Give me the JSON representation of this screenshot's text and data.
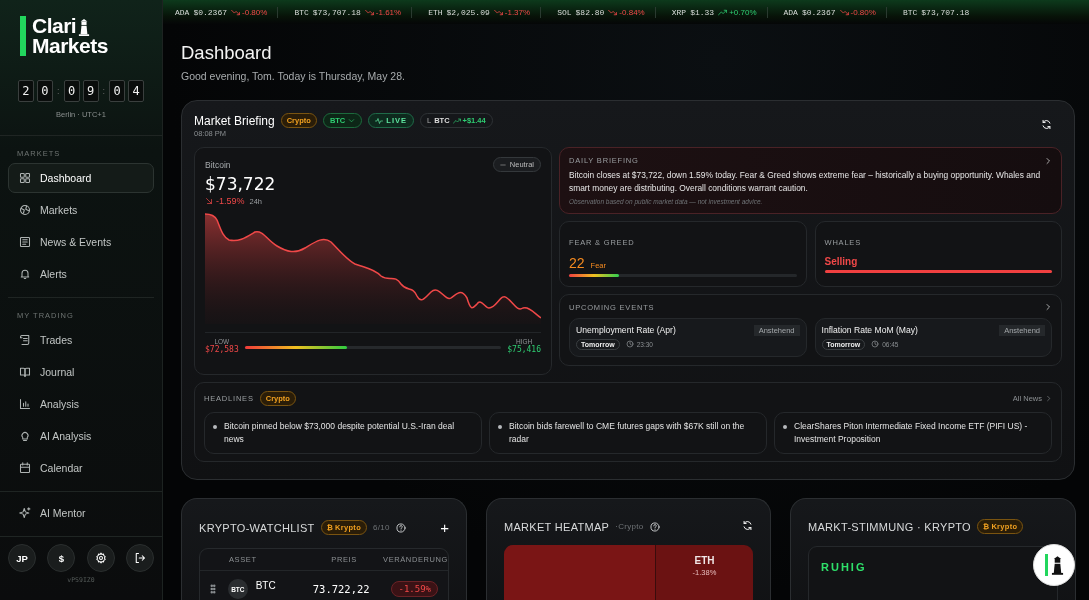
{
  "ticker": [
    {
      "symbol": "ADA",
      "price": "$0.2367",
      "change": "-0.80%",
      "falling": true
    },
    {
      "symbol": "BTC",
      "price": "$73,707.18",
      "change": "-1.61%",
      "falling": true
    },
    {
      "symbol": "ETH",
      "price": "$2,025.09",
      "change": "-1.37%",
      "falling": true
    },
    {
      "symbol": "SOL",
      "price": "$82.80",
      "change": "-0.84%",
      "falling": true
    },
    {
      "symbol": "XRP",
      "price": "$1.33",
      "change": "+0.70%",
      "falling": false
    },
    {
      "symbol": "ADA",
      "price": "$0.2367",
      "change": "-0.80%",
      "falling": true
    },
    {
      "symbol": "BTC",
      "price": "$73,707.18"
    }
  ],
  "sidebar": {
    "logo": {
      "line1": "Clari",
      "line2": "Markets"
    },
    "clock": {
      "groups": [
        [
          "2",
          "0"
        ],
        [
          "0",
          "9"
        ],
        [
          "0",
          "4"
        ]
      ],
      "separator": ":",
      "zone": "Berlin · UTC+1"
    },
    "sections": [
      {
        "title": "MARKETS",
        "items": [
          {
            "label": "Dashboard",
            "selected": true
          },
          {
            "label": "Markets",
            "selected": false
          },
          {
            "label": "News & Events",
            "selected": false
          },
          {
            "label": "Alerts",
            "selected": false
          }
        ]
      },
      {
        "title": "MY TRADING",
        "items": [
          {
            "label": "Trades",
            "selected": false
          },
          {
            "label": "Journal",
            "selected": false
          },
          {
            "label": "Analysis",
            "selected": false
          },
          {
            "label": "AI Analysis",
            "selected": false
          },
          {
            "label": "Calendar",
            "selected": false
          }
        ]
      }
    ],
    "mentor": "AI Mentor",
    "footer": {
      "avatar": "JP",
      "currency": "$",
      "version": "vPS9IZ0"
    }
  },
  "header": {
    "title": "Dashboard",
    "greeting": "Good evening, Tom. Today is Thursday, May 28."
  },
  "briefing": {
    "title": "Market Briefing",
    "badge": "Crypto",
    "asset_select": "BTC",
    "live": "LIVE",
    "live_prefix": "L",
    "live_symbol": "BTC",
    "live_change": "+$1.44",
    "time": "08:08 PM",
    "price_panel": {
      "name": "Bitcoin",
      "price": "$73,722",
      "change": "-1.59%",
      "period": "24h",
      "sentiment": "Neutral",
      "low_label": "LOW",
      "low": "$72,583",
      "high_label": "HIGH",
      "high": "$75,416",
      "level": 0.4
    },
    "daily": {
      "title": "DAILY BRIEFING",
      "text": "Bitcoin closes at $73,722, down 1.59% today. Fear & Greed shows extreme fear – historically a buying opportunity. Whales and smart money are distributing. Overall conditions warrant caution.",
      "disclaimer": "Observation based on public market data — not investment advice."
    },
    "fear_greed": {
      "title": "FEAR & GREED",
      "value": "22",
      "label": "Fear",
      "level": 0.22
    },
    "whales": {
      "title": "WHALES",
      "label": "Selling",
      "level": 1
    },
    "events": {
      "title": "UPCOMING EVENTS",
      "items": [
        {
          "name": "Unemployment Rate (Apr)",
          "status": "Anstehend",
          "day": "Tomorrow",
          "time": "23:30"
        },
        {
          "name": "Inflation Rate MoM (May)",
          "status": "Anstehend",
          "day": "Tomorrow",
          "time": "06:45"
        }
      ]
    },
    "headlines": {
      "title": "HEADLINES",
      "badge": "Crypto",
      "link": "All News",
      "items": [
        "Bitcoin pinned below $73,000 despite potential U.S.-Iran deal news",
        "Bitcoin bids farewell to CME futures gaps with $67K still on the radar",
        "ClearShares Piton Intermediate Fixed Income ETF (PIFI US) - Investment Proposition"
      ]
    }
  },
  "watchlist": {
    "title": "KRYPTO-WATCHLIST",
    "badge_icon": "₿",
    "badge": "Krypto",
    "count": "6/10",
    "add": "+",
    "columns": [
      "ASSET",
      "PREIS",
      "VERÄNDERUNG"
    ],
    "rows": [
      {
        "logo": "BTC",
        "symbol": "BTC",
        "price": "73.722,22",
        "change": "-1.59%",
        "falling": true
      }
    ]
  },
  "heatmap": {
    "title": "MARKET HEATMAP",
    "subtitle": "·Crypto",
    "cells": [
      {
        "color": "#7a1515"
      },
      {
        "symbol": "ETH",
        "change": "-1.38%",
        "color": "#6b1212"
      }
    ]
  },
  "sentiment": {
    "title": "MARKT-STIMMUNG · KRYPTO",
    "badge_icon": "₿",
    "badge": "Krypto",
    "state": "RUHIG"
  }
}
